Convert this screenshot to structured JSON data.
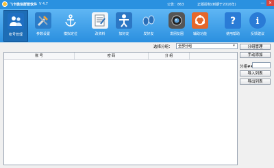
{
  "titlebar": {
    "title": "飞卡微信群管软件",
    "version": "V 4.7",
    "msg_count_text": "公告：863",
    "status_text": "正版授权(到期于2016年)"
  },
  "toolbar": {
    "items": [
      {
        "label": "帐号管理",
        "icon": "accounts-icon",
        "color": "#2a7bd6"
      },
      {
        "label": "参数设置",
        "icon": "settings-icon",
        "color": "#3b86cf"
      },
      {
        "label": "模拟定位",
        "icon": "anchor-icon",
        "color": "#3b86cf"
      },
      {
        "label": "改资料",
        "icon": "edit-profile-icon",
        "color": "#eef3f7"
      },
      {
        "label": "加好友",
        "icon": "add-friend-icon",
        "color": "#3b86cf"
      },
      {
        "label": "发好友",
        "icon": "send-friend-icon",
        "color": "#3b86cf"
      },
      {
        "label": "发朋友圈",
        "icon": "camera-icon",
        "color": "#333333"
      },
      {
        "label": "辅助功能",
        "icon": "tools-icon",
        "color": "#e66c2c"
      },
      {
        "label": "使用帮助",
        "icon": "help-icon",
        "color": "#2a7bd6"
      },
      {
        "label": "反馈建议",
        "icon": "info-icon",
        "color": "#2a7bd6"
      }
    ]
  },
  "main": {
    "group_label": "选择分组：",
    "group_selected": "全部分组",
    "columns": [
      "账  号",
      "密  码",
      "分  组"
    ]
  },
  "side": {
    "group_manage": "分组管理",
    "manual_add": "手动添加",
    "group_num_label": "分组##",
    "import_list": "导入列表",
    "export_list": "导出列表"
  }
}
